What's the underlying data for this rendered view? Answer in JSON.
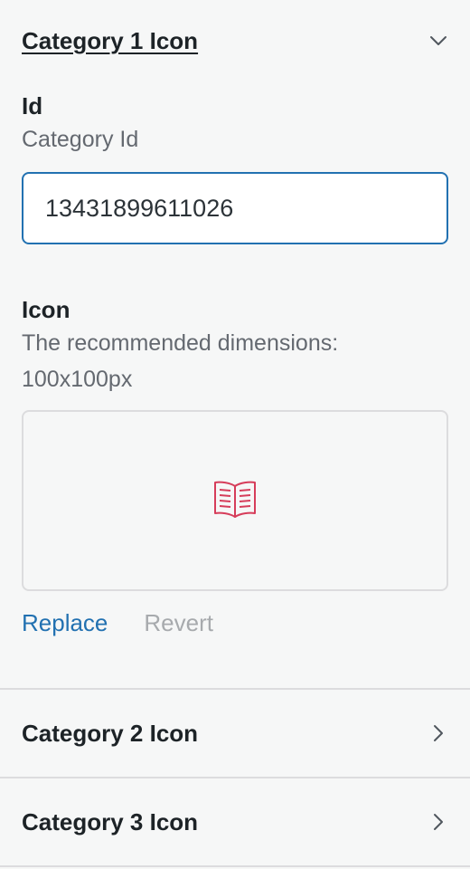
{
  "sections": [
    {
      "title": "Category 1 Icon",
      "expanded": true,
      "chevron_icon": "chevron-down-icon",
      "id_field": {
        "label": "Id",
        "description": "Category Id",
        "value": "13431899611026"
      },
      "icon_field": {
        "label": "Icon",
        "description": "The recommended dimensions: 100x100px",
        "image_icon": "open-book-icon",
        "image_icon_color": "#d63d5a"
      },
      "actions": {
        "replace_label": "Replace",
        "revert_label": "Revert"
      }
    },
    {
      "title": "Category 2 Icon",
      "expanded": false,
      "chevron_icon": "chevron-right-icon"
    },
    {
      "title": "Category 3 Icon",
      "expanded": false,
      "chevron_icon": "chevron-right-icon"
    }
  ],
  "colors": {
    "accent": "#2271b1",
    "disabled": "#a7aaad",
    "border": "#dcdcde",
    "background": "#f6f7f7"
  }
}
